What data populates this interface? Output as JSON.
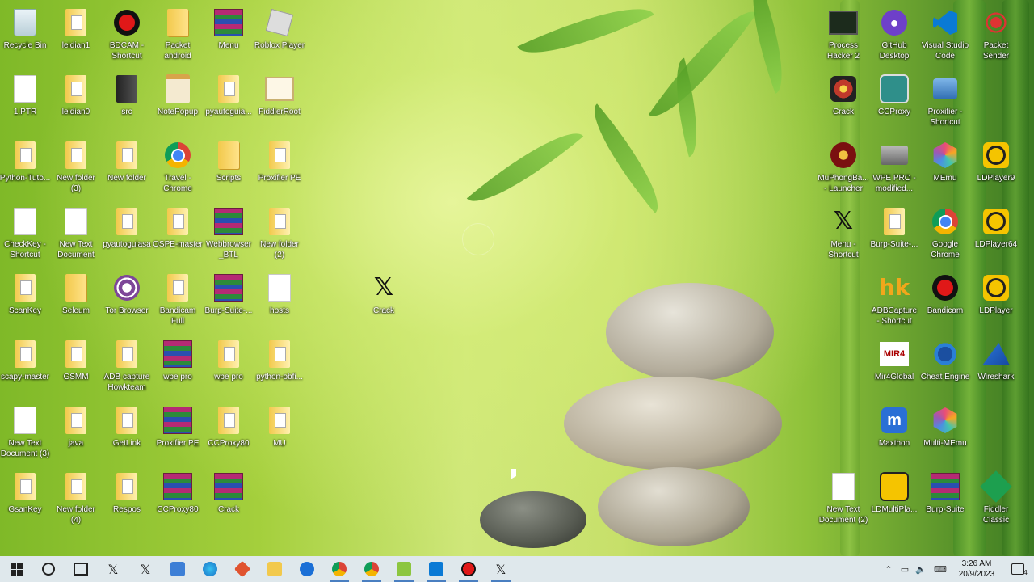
{
  "desktop": {
    "left_icons": [
      {
        "label": "Recycle Bin",
        "icon": "recycle-bin-icon",
        "col": 0,
        "row": 0,
        "glyph": "recycle"
      },
      {
        "label": "leidian1",
        "icon": "folder-icon",
        "col": 1,
        "row": 0,
        "glyph": "folder-doc"
      },
      {
        "label": "BDCAM -\nShortcut",
        "icon": "bandicam-icon",
        "col": 2,
        "row": 0,
        "glyph": "rec"
      },
      {
        "label": "Packet\nandroid",
        "icon": "folder-icon",
        "col": 3,
        "row": 0,
        "glyph": "folder"
      },
      {
        "label": "Menu",
        "icon": "winrar-icon",
        "col": 4,
        "row": 0,
        "glyph": "rar"
      },
      {
        "label": "Roblox Player",
        "icon": "roblox-icon",
        "col": 5,
        "row": 0,
        "glyph": "roblox"
      },
      {
        "label": "1.PTR",
        "icon": "document-icon",
        "col": 0,
        "row": 1,
        "glyph": "doc"
      },
      {
        "label": "leidian0",
        "icon": "folder-icon",
        "col": 1,
        "row": 1,
        "glyph": "folder-doc"
      },
      {
        "label": "src",
        "icon": "folder-icon",
        "col": 2,
        "row": 1,
        "glyph": "darkfolder"
      },
      {
        "label": "NotePopup",
        "icon": "notepad-icon",
        "col": 3,
        "row": 1,
        "glyph": "notepad"
      },
      {
        "label": "pyautoguia...",
        "icon": "folder-icon",
        "col": 4,
        "row": 1,
        "glyph": "folder-doc"
      },
      {
        "label": "FiddlerRoot",
        "icon": "certificate-icon",
        "col": 5,
        "row": 1,
        "glyph": "cert"
      },
      {
        "label": "Python-Tuto...",
        "icon": "folder-icon",
        "col": 0,
        "row": 2,
        "glyph": "folder-doc"
      },
      {
        "label": "New folder\n(3)",
        "icon": "folder-icon",
        "col": 1,
        "row": 2,
        "glyph": "folder-doc"
      },
      {
        "label": "New folder",
        "icon": "folder-icon",
        "col": 2,
        "row": 2,
        "glyph": "folder-doc"
      },
      {
        "label": "Travel -\nChrome",
        "icon": "chrome-icon",
        "col": 3,
        "row": 2,
        "glyph": "chrome"
      },
      {
        "label": "Scripts",
        "icon": "folder-icon",
        "col": 4,
        "row": 2,
        "glyph": "folder"
      },
      {
        "label": "Proxifier PE",
        "icon": "folder-icon",
        "col": 5,
        "row": 2,
        "glyph": "folder-doc"
      },
      {
        "label": "CheckKey -\nShortcut",
        "icon": "document-icon",
        "col": 0,
        "row": 3,
        "glyph": "doc"
      },
      {
        "label": "New Text\nDocument",
        "icon": "text-document-icon",
        "col": 1,
        "row": 3,
        "glyph": "doc"
      },
      {
        "label": "pyautoguiasa",
        "icon": "folder-icon",
        "col": 2,
        "row": 3,
        "glyph": "folder-doc"
      },
      {
        "label": "OSPE-master",
        "icon": "folder-icon",
        "col": 3,
        "row": 3,
        "glyph": "folder-doc"
      },
      {
        "label": "Webbrowser\n_BTL",
        "icon": "winrar-icon",
        "col": 4,
        "row": 3,
        "glyph": "rar"
      },
      {
        "label": "New folder\n(2)",
        "icon": "folder-icon",
        "col": 5,
        "row": 3,
        "glyph": "folder-doc"
      },
      {
        "label": "ScanKey",
        "icon": "folder-icon",
        "col": 0,
        "row": 4,
        "glyph": "folder-doc"
      },
      {
        "label": "Seleum",
        "icon": "folder-icon",
        "col": 1,
        "row": 4,
        "glyph": "folder"
      },
      {
        "label": "Tor Browser",
        "icon": "tor-browser-icon",
        "col": 2,
        "row": 4,
        "glyph": "tor"
      },
      {
        "label": "Bandicam\nFull",
        "icon": "bandicam-icon",
        "col": 3,
        "row": 4,
        "glyph": "folder-doc"
      },
      {
        "label": "Burp-Suite-...",
        "icon": "winrar-icon",
        "col": 4,
        "row": 4,
        "glyph": "rar"
      },
      {
        "label": "hosts",
        "icon": "document-icon",
        "col": 5,
        "row": 4,
        "glyph": "doc"
      },
      {
        "label": "scapy-master",
        "icon": "folder-icon",
        "col": 0,
        "row": 5,
        "glyph": "folder-doc"
      },
      {
        "label": "GSMM",
        "icon": "folder-icon",
        "col": 1,
        "row": 5,
        "glyph": "folder-doc"
      },
      {
        "label": "ADB capture\nHowkteam",
        "icon": "folder-icon",
        "col": 2,
        "row": 5,
        "glyph": "folder-doc"
      },
      {
        "label": "wpe pro",
        "icon": "winrar-icon",
        "col": 3,
        "row": 5,
        "glyph": "rar"
      },
      {
        "label": "wpe pro",
        "icon": "folder-icon",
        "col": 4,
        "row": 5,
        "glyph": "folder-doc"
      },
      {
        "label": "python-obfi...",
        "icon": "folder-icon",
        "col": 5,
        "row": 5,
        "glyph": "folder-doc"
      },
      {
        "label": "New Text\nDocument (3)",
        "icon": "text-document-icon",
        "col": 0,
        "row": 6,
        "glyph": "doc"
      },
      {
        "label": "java",
        "icon": "folder-icon",
        "col": 1,
        "row": 6,
        "glyph": "folder-doc"
      },
      {
        "label": "GetLink",
        "icon": "folder-icon",
        "col": 2,
        "row": 6,
        "glyph": "folder-doc"
      },
      {
        "label": "Proxifier PE",
        "icon": "winrar-icon",
        "col": 3,
        "row": 6,
        "glyph": "rar"
      },
      {
        "label": "CCProxy80",
        "icon": "folder-icon",
        "col": 4,
        "row": 6,
        "glyph": "folder-doc"
      },
      {
        "label": "MU",
        "icon": "folder-icon",
        "col": 5,
        "row": 6,
        "glyph": "folder-doc"
      },
      {
        "label": "GsanKey",
        "icon": "folder-icon",
        "col": 0,
        "row": 7,
        "glyph": "folder-doc"
      },
      {
        "label": "New folder\n(4)",
        "icon": "folder-icon",
        "col": 1,
        "row": 7,
        "glyph": "folder-doc"
      },
      {
        "label": "Respos",
        "icon": "folder-icon",
        "col": 2,
        "row": 7,
        "glyph": "folder-doc"
      },
      {
        "label": "CCProxy80",
        "icon": "winrar-icon",
        "col": 3,
        "row": 7,
        "glyph": "rar"
      },
      {
        "label": "Crack",
        "icon": "winrar-icon",
        "col": 4,
        "row": 7,
        "glyph": "rar"
      }
    ],
    "middle_icon": {
      "label": "Crack",
      "icon": "x-app-icon"
    },
    "right_icons": [
      {
        "label": "Process\nHacker 2",
        "icon": "process-hacker-icon",
        "col": 0,
        "row": 0,
        "glyph": "monitor"
      },
      {
        "label": "GitHub\nDesktop",
        "icon": "github-desktop-icon",
        "col": 1,
        "row": 0,
        "glyph": "github"
      },
      {
        "label": "Visual Studio\nCode",
        "icon": "vscode-icon",
        "col": 2,
        "row": 0,
        "glyph": "vscode"
      },
      {
        "label": "Packet\nSender",
        "icon": "packet-sender-icon",
        "col": 3,
        "row": 0,
        "glyph": "packet"
      },
      {
        "label": "Crack",
        "icon": "crack-icon",
        "col": 0,
        "row": 1,
        "glyph": "crack"
      },
      {
        "label": "CCProxy",
        "icon": "ccproxy-icon",
        "col": 1,
        "row": 1,
        "glyph": "ccproxy"
      },
      {
        "label": "Proxifier -\nShortcut",
        "icon": "proxifier-icon",
        "col": 2,
        "row": 1,
        "glyph": "proxifier"
      },
      {
        "label": "MuPhongBa...\n- Launcher",
        "icon": "mu-launcher-icon",
        "col": 0,
        "row": 2,
        "glyph": "mu"
      },
      {
        "label": "WPE PRO -\nmodified...",
        "icon": "wpe-pro-icon",
        "col": 1,
        "row": 2,
        "glyph": "wpe"
      },
      {
        "label": "MEmu",
        "icon": "memu-icon",
        "col": 2,
        "row": 2,
        "glyph": "memu"
      },
      {
        "label": "LDPlayer9",
        "icon": "ldplayer-icon",
        "col": 3,
        "row": 2,
        "glyph": "ld"
      },
      {
        "label": "Menu -\nShortcut",
        "icon": "x-app-icon",
        "col": 0,
        "row": 3,
        "glyph": "x"
      },
      {
        "label": "Burp-Suite-...",
        "icon": "folder-icon",
        "col": 1,
        "row": 3,
        "glyph": "folder-doc"
      },
      {
        "label": "Google\nChrome",
        "icon": "chrome-icon",
        "col": 2,
        "row": 3,
        "glyph": "chrome"
      },
      {
        "label": "LDPlayer64",
        "icon": "ldplayer-icon",
        "col": 3,
        "row": 3,
        "glyph": "ld"
      },
      {
        "label": "ADBCapture\n- Shortcut",
        "icon": "adbcapture-icon",
        "col": 1,
        "row": 4,
        "glyph": "hk"
      },
      {
        "label": "Bandicam",
        "icon": "bandicam-icon",
        "col": 2,
        "row": 4,
        "glyph": "rec"
      },
      {
        "label": "LDPlayer",
        "icon": "ldplayer-icon",
        "col": 3,
        "row": 4,
        "glyph": "ld"
      },
      {
        "label": "Mir4Global",
        "icon": "mir4-icon",
        "col": 1,
        "row": 5,
        "glyph": "mir4"
      },
      {
        "label": "Cheat Engine",
        "icon": "cheat-engine-icon",
        "col": 2,
        "row": 5,
        "glyph": "cheat"
      },
      {
        "label": "Wireshark",
        "icon": "wireshark-icon",
        "col": 3,
        "row": 5,
        "glyph": "wireshark"
      },
      {
        "label": "Maxthon",
        "icon": "maxthon-icon",
        "col": 1,
        "row": 6,
        "glyph": "maxthon"
      },
      {
        "label": "Multi-MEmu",
        "icon": "memu-icon",
        "col": 2,
        "row": 6,
        "glyph": "memu"
      },
      {
        "label": "New Text\nDocument (2)",
        "icon": "text-document-icon",
        "col": 0,
        "row": 7,
        "glyph": "doc"
      },
      {
        "label": "LDMultiPla...",
        "icon": "ldmultiplayer-icon",
        "col": 1,
        "row": 7,
        "glyph": "ldmulti"
      },
      {
        "label": "Burp-Suite",
        "icon": "winrar-icon",
        "col": 2,
        "row": 7,
        "glyph": "rar"
      },
      {
        "label": "Fiddler\nClassic",
        "icon": "fiddler-icon",
        "col": 3,
        "row": 7,
        "glyph": "fiddler"
      }
    ]
  },
  "taskbar": {
    "items": [
      {
        "icon": "windows-start-icon",
        "active": false
      },
      {
        "icon": "search-icon",
        "active": false
      },
      {
        "icon": "task-view-icon",
        "active": false
      },
      {
        "icon": "x-app-icon",
        "active": false
      },
      {
        "icon": "x-app-icon",
        "active": false
      },
      {
        "icon": "visual-studio-icon",
        "active": false
      },
      {
        "icon": "edge-icon",
        "active": false
      },
      {
        "icon": "git-icon",
        "active": false
      },
      {
        "icon": "file-explorer-icon",
        "active": false
      },
      {
        "icon": "teamviewer-icon",
        "active": false
      },
      {
        "icon": "chrome-icon",
        "active": true
      },
      {
        "icon": "chrome-icon",
        "active": true
      },
      {
        "icon": "notepad-plus-icon",
        "active": true
      },
      {
        "icon": "vscode-icon",
        "active": true
      },
      {
        "icon": "bandicam-icon",
        "active": true
      },
      {
        "icon": "x-app-icon",
        "active": true
      }
    ],
    "tray": {
      "time": "3:26 AM",
      "date": "20/9/2023",
      "notification_count": "4"
    }
  }
}
